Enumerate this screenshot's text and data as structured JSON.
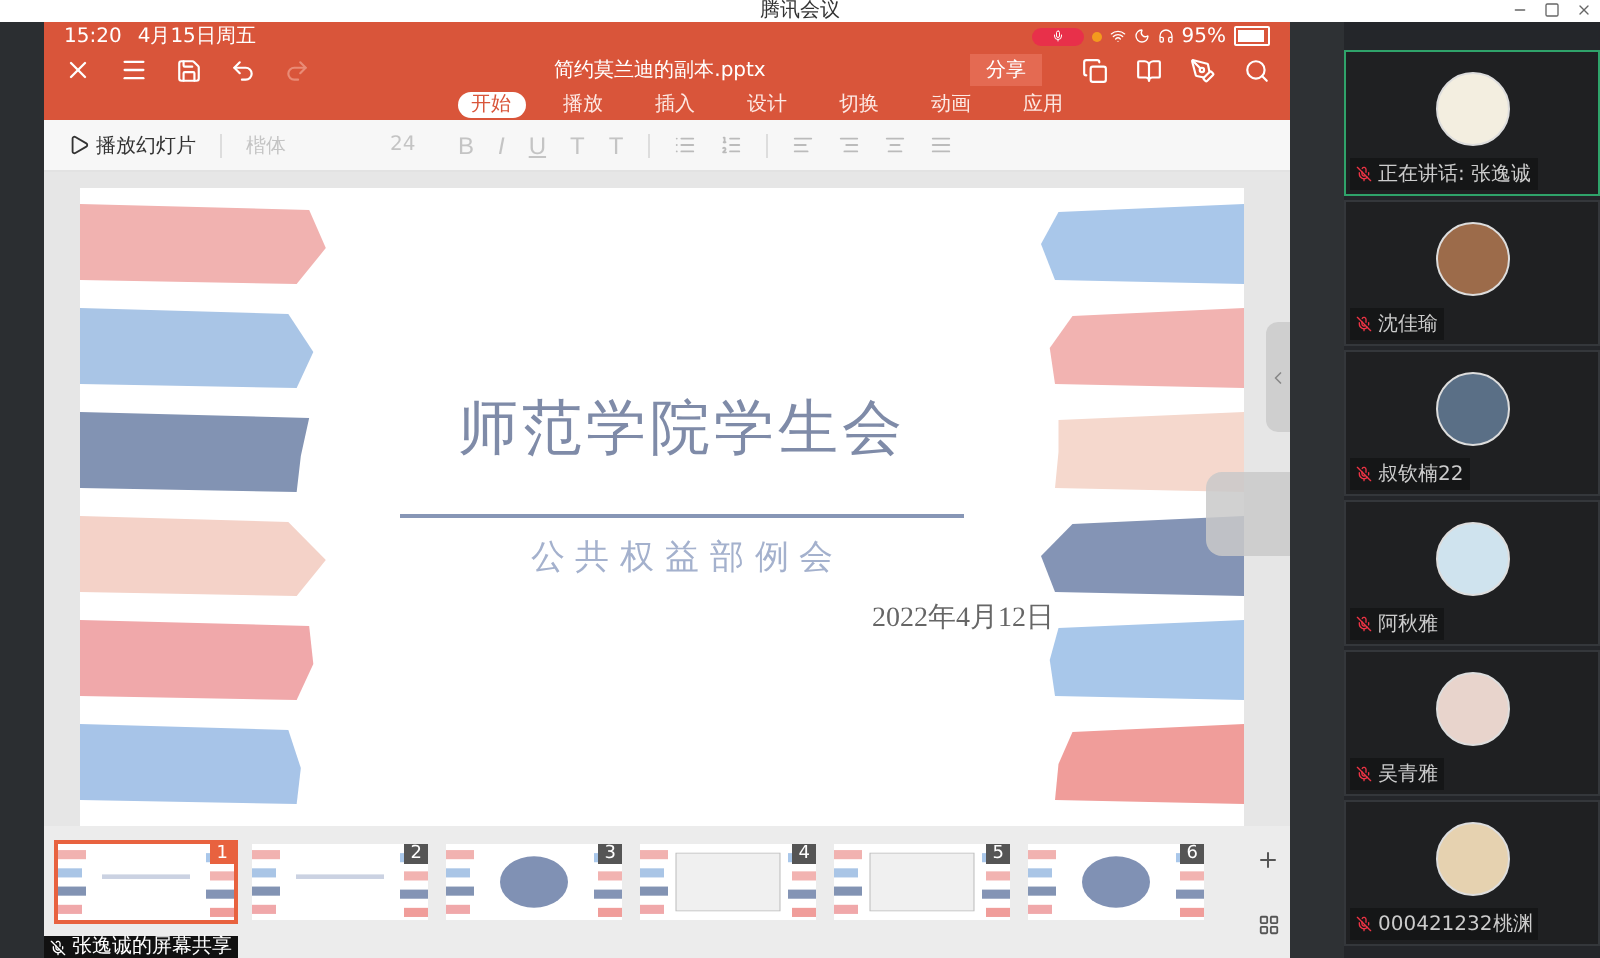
{
  "window": {
    "title": "腾讯会议"
  },
  "status_bar": {
    "time": "15:20",
    "date": "4月15日周五",
    "battery": "95%"
  },
  "document": {
    "title": "简约莫兰迪的副本.pptx",
    "share": "分享"
  },
  "ribbon_tabs": [
    {
      "label": "开始",
      "selected": true
    },
    {
      "label": "播放",
      "selected": false
    },
    {
      "label": "插入",
      "selected": false
    },
    {
      "label": "设计",
      "selected": false
    },
    {
      "label": "切换",
      "selected": false
    },
    {
      "label": "动画",
      "selected": false
    },
    {
      "label": "应用",
      "selected": false
    }
  ],
  "toolbar": {
    "play": "播放幻灯片",
    "font": "楷体",
    "size": "24",
    "format_buttons": [
      "B",
      "I",
      "U",
      "T",
      "T"
    ]
  },
  "slide": {
    "title": "师范学院学生会",
    "subtitle": "公 共 权 益 部 例 会",
    "date": "2022年4月12日"
  },
  "thumbnails": [
    {
      "number": "1",
      "selected": true
    },
    {
      "number": "2",
      "selected": false
    },
    {
      "number": "3",
      "selected": false
    },
    {
      "number": "4",
      "selected": false
    },
    {
      "number": "5",
      "selected": false
    },
    {
      "number": "6",
      "selected": false
    }
  ],
  "participants": [
    {
      "name": "正在讲话: 张逸诚",
      "speaking": true
    },
    {
      "name": "沈佳瑜",
      "speaking": false
    },
    {
      "name": "叔钦楠22",
      "speaking": false
    },
    {
      "name": "阿秋雅",
      "speaking": false
    },
    {
      "name": "吴青雅",
      "speaking": false
    },
    {
      "name": "000421232桃渊",
      "speaking": false
    }
  ],
  "share_label": "张逸诚的屏幕共享"
}
